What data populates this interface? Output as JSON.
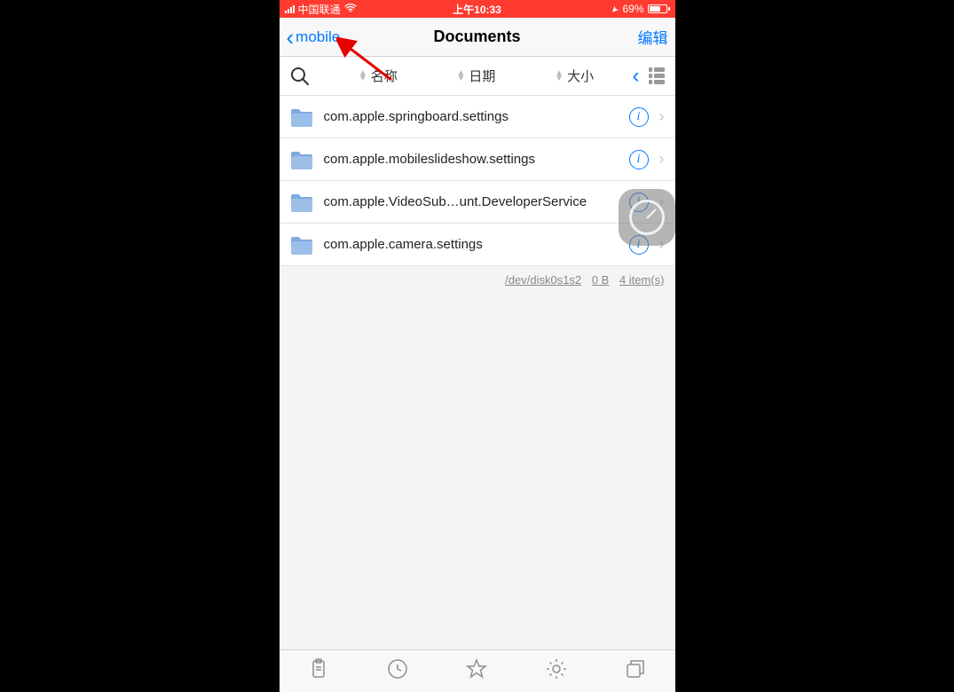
{
  "status_bar": {
    "carrier": "中国联通",
    "time": "上午10:33",
    "battery_pct": "69%"
  },
  "nav": {
    "back_label": "mobile",
    "title": "Documents",
    "edit_label": "编辑"
  },
  "sort": {
    "name": "名称",
    "date": "日期",
    "size": "大小"
  },
  "files": [
    {
      "name": "com.apple.springboard.settings"
    },
    {
      "name": "com.apple.mobileslideshow.settings"
    },
    {
      "name": "com.apple.VideoSub…unt.DeveloperService"
    },
    {
      "name": "com.apple.camera.settings"
    }
  ],
  "summary": {
    "disk": "/dev/disk0s1s2",
    "bytes": "0 B",
    "count": "4 item(s)"
  }
}
